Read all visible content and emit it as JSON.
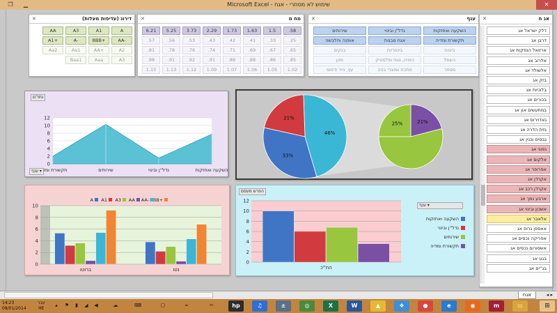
{
  "window": {
    "title": "Microsoft Excel - שימוש לא מסחרי - אגח"
  },
  "window_buttons": {
    "minimize": "▁",
    "maximize": "❐",
    "close": "✕"
  },
  "slicers": {
    "rating": {
      "title": "דירוג (עדיפות מעלות)",
      "filter_icon": "✕",
      "rows": [
        [
          "A",
          "A1",
          "A3",
          "AA"
        ],
        [
          "AA-",
          "BBB+",
          "A-",
          "A1+"
        ],
        [
          "A2",
          "AA+",
          "Aa1",
          "Aa2"
        ],
        [
          "A3",
          "Aaa",
          "Baa1",
          ""
        ]
      ]
    },
    "duration": {
      "title": "מח מ",
      "filter_icon": "✕",
      "rows": [
        [
          ".58",
          "1.5",
          "1.63",
          "1.73",
          "2.29",
          "3.73",
          "5.25",
          "6.21"
        ],
        [
          ".25",
          ".33",
          ".41",
          ".42",
          ".43",
          ".53",
          ".56",
          ".57"
        ],
        [
          ".65",
          ".67",
          ".69",
          ".71",
          ".74",
          ".76",
          ".78",
          ".81"
        ],
        [
          ".85",
          ".86",
          ".88",
          ".89",
          ".91",
          ".92",
          ".91",
          ".98"
        ],
        [
          "1.02",
          "1.05",
          "1.06",
          "1.07",
          "1.09",
          "1.12",
          "1.13",
          "1.15"
        ]
      ]
    },
    "branch": {
      "title": "ענף",
      "filter_icon": "✕",
      "rows": [
        [
          "השקעה ואחזקות",
          "גדל\"ן ובינוי",
          "שירותים"
        ],
        [
          "תקשורת ומדיה",
          "אגח מבנות",
          "אופנה והלבשה"
        ],
        [
          "ביטוח",
          "ביטוריות",
          "בנקים"
        ],
        [
          "השמל",
          "כימיה, גומי ופלסטיק",
          "מזון"
        ],
        [
          "מסחר",
          "מתכת ומוצרי בניה",
          "עץ, נייר ודפוס"
        ]
      ]
    }
  },
  "bond_list": {
    "title": "אג ח",
    "filter_icon": "✕",
    "items": [
      {
        "label": "דלק ישראל אג",
        "style": "white"
      },
      {
        "label": "דרבן אג",
        "style": "white"
      },
      {
        "label": "ארזואל הנפקות אג",
        "style": "white"
      },
      {
        "label": "אלרוב אג",
        "style": "white"
      },
      {
        "label": "אלשולד אג",
        "style": "white"
      },
      {
        "label": "בזק אג",
        "style": "white"
      },
      {
        "label": "בלוכיות אג",
        "style": "white"
      },
      {
        "label": "בכורים אג",
        "style": "white"
      },
      {
        "label": "במתעשים און אג",
        "style": "white"
      },
      {
        "label": "גאדוירוס אג",
        "style": "white"
      },
      {
        "label": "גזית הדרה אג",
        "style": "white"
      },
      {
        "label": "גבסים ובנין אג",
        "style": "white"
      },
      {
        "label": "גפוני אג",
        "style": "pink"
      },
      {
        "label": "אלקום אג",
        "style": "pink"
      },
      {
        "label": "אפרופר אג",
        "style": "pink"
      },
      {
        "label": "אקרדן אג",
        "style": "pink"
      },
      {
        "label": "אקרדן רכב אג",
        "style": "pink"
      },
      {
        "label": "ארבע נמך אג",
        "style": "pink"
      },
      {
        "label": "אשכון ובינוי אג",
        "style": "pink"
      },
      {
        "label": "אלאבר אג",
        "style": "yellow"
      },
      {
        "label": "אאספן גרופ אג",
        "style": "white"
      },
      {
        "label": "אפריקה נכסים אג",
        "style": "white"
      },
      {
        "label": "אשסורום נכסים אג",
        "style": "white"
      },
      {
        "label": "בגוג אג",
        "style": "white"
      },
      {
        "label": "בג''ים אג",
        "style": "white"
      }
    ]
  },
  "colors": {
    "area_fill": "#5bc2d6",
    "pie_red": "#d13b3f",
    "pie_blue": "#3f75c4",
    "pie_cyan": "#3bb7d6",
    "pie_green": "#98c63e",
    "pie_purple": "#7a4fa4",
    "bar_A": "#3f75c4",
    "bar_A1": "#d13b3f",
    "bar_A3": "#98c63e",
    "bar_AA": "#7a4fa4",
    "bar_AAminus": "#3bb7d6",
    "bar_BBBplus": "#f08534"
  },
  "charts": {
    "area": {
      "tag": "נתו''ם",
      "filter_label": "ענף ▾"
    },
    "bar_right": {
      "tag": "הפרש מעסם",
      "filter_label": "ענף ▾"
    }
  },
  "chart_data": [
    {
      "type": "area",
      "categories": [
        "השקעה ואחזקות",
        "נדל''ן ובינוי",
        "שירותים",
        "תקשורת ומדיה"
      ],
      "values": [
        2,
        10.3,
        1.5,
        7.7
      ],
      "ylim": [
        0,
        12
      ],
      "yticks": [
        0,
        2,
        4,
        6,
        8,
        10,
        12
      ]
    },
    {
      "type": "pie",
      "slices": [
        {
          "value": 46,
          "label": "46%",
          "color": "#3bb7d6"
        },
        {
          "value": 33,
          "label": "33%",
          "color": "#3f75c4"
        },
        {
          "value": 21,
          "label": "21%",
          "color": "#d13b3f"
        }
      ]
    },
    {
      "type": "pie",
      "slices": [
        {
          "value": 21,
          "label": "21%",
          "color": "#7a4fa4"
        },
        {
          "value": 54,
          "label": "",
          "color": "#98c63e"
        },
        {
          "value": 25,
          "label": "25%",
          "color": "#98c63e"
        }
      ]
    },
    {
      "type": "bar",
      "categories": [
        "ברוטו",
        "נטו"
      ],
      "series": [
        {
          "name": "A",
          "values": [
            5.3,
            3.8
          ],
          "color": "#3f75c4"
        },
        {
          "name": "A1",
          "values": [
            3.2,
            2.2
          ],
          "color": "#d13b3f"
        },
        {
          "name": "A3",
          "values": [
            3.6,
            3.0
          ],
          "color": "#98c63e"
        },
        {
          "name": "AA",
          "values": [
            0.6,
            0.5
          ],
          "color": "#7a4fa4"
        },
        {
          "name": "AA-",
          "values": [
            5.4,
            4.3
          ],
          "color": "#3bb7d6"
        },
        {
          "name": "BBB+",
          "values": [
            9.2,
            6.8
          ],
          "color": "#f08534"
        }
      ],
      "ylim": [
        0,
        10
      ],
      "yticks": [
        0,
        2,
        4,
        6,
        8,
        10
      ]
    },
    {
      "type": "bar",
      "categories": [
        "הח''כ"
      ],
      "series": [
        {
          "name": "השקעה ואחזקות",
          "values": [
            10
          ],
          "color": "#3f75c4"
        },
        {
          "name": "נדל''ן ובינוי",
          "values": [
            6
          ],
          "color": "#d13b3f"
        },
        {
          "name": "שירותים",
          "values": [
            6.8
          ],
          "color": "#98c63e"
        },
        {
          "name": "תקשורת ומדיה",
          "values": [
            3.6
          ],
          "color": "#7a4fa4"
        }
      ],
      "ylim": [
        0,
        12
      ],
      "yticks": [
        0,
        2,
        4,
        6,
        8,
        10,
        12
      ]
    }
  ],
  "sheet_tabs": {
    "active": "אגח"
  },
  "taskbar": {
    "time": "14:23",
    "date": "08/01/2014",
    "lang_top": "עבר",
    "lang_bottom": "HE",
    "apps": [
      {
        "icon": "hp-icon",
        "glyph": "hp",
        "color": "#2d2d2d"
      },
      {
        "icon": "itunes-icon",
        "glyph": "♫",
        "color": "#2f6fd4"
      },
      {
        "icon": "calculator-icon",
        "glyph": "±",
        "color": "#5a6f88"
      },
      {
        "icon": "compass-icon",
        "glyph": "◎",
        "color": "#4a8a3c"
      },
      {
        "icon": "excel-icon",
        "glyph": "X",
        "color": "#1e7145"
      },
      {
        "icon": "word-icon",
        "glyph": "W",
        "color": "#2b579a"
      },
      {
        "icon": "drive-icon",
        "glyph": "▲",
        "color": "#e6b833"
      },
      {
        "icon": "dropbox-icon",
        "glyph": "❖",
        "color": "#3d8fd6"
      },
      {
        "icon": "chrome-icon",
        "glyph": "●",
        "color": "#d9483b"
      },
      {
        "icon": "ie-icon",
        "glyph": "e",
        "color": "#2a7ad0"
      },
      {
        "icon": "firefox-icon",
        "glyph": "◉",
        "color": "#e66a1d"
      },
      {
        "icon": "mendeley-icon",
        "glyph": "m",
        "color": "#a31f34"
      },
      {
        "icon": "folder-icon",
        "glyph": "▭",
        "color": "#d9a53a"
      }
    ]
  }
}
